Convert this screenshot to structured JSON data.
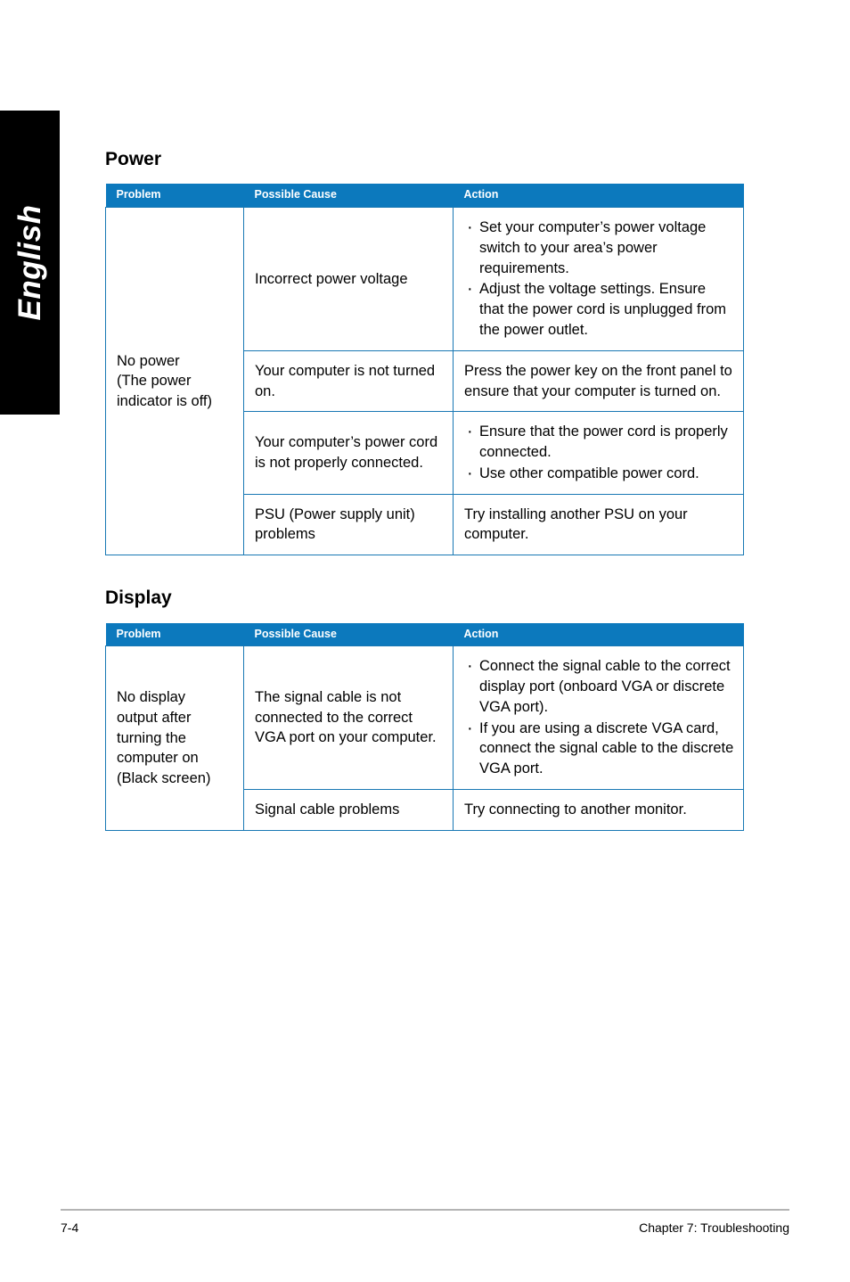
{
  "language_tab": {
    "label": "English"
  },
  "sections": [
    {
      "title": "Power",
      "columns": [
        "Problem",
        "Possible Cause",
        "Action"
      ],
      "rows": [
        {
          "problem": "No power\n(The power\nindicator is off)",
          "problem_rowspan": 4,
          "cause": "Incorrect power voltage",
          "action_bullets": [
            "Set your computer’s power voltage switch to your area’s power requirements.",
            "Adjust the voltage settings. Ensure that the power cord is unplugged from the power outlet."
          ]
        },
        {
          "cause": "Your computer is not turned on.",
          "action_text": "Press the power key on the front panel to ensure that your computer is turned on."
        },
        {
          "cause": "Your computer’s power cord is not properly connected.",
          "action_bullets": [
            "Ensure that the power cord is properly connected.",
            "Use other compatible power cord."
          ]
        },
        {
          "cause": "PSU (Power supply unit) problems",
          "action_text": "Try installing another PSU on your computer."
        }
      ]
    },
    {
      "title": "Display",
      "columns": [
        "Problem",
        "Possible Cause",
        "Action"
      ],
      "rows": [
        {
          "problem": "No display\noutput after\nturning the\ncomputer on\n(Black screen)",
          "problem_rowspan": 2,
          "cause": "The signal cable is not connected to the correct VGA port on your computer.",
          "action_bullets": [
            "Connect the signal cable to the correct display port (onboard VGA or discrete VGA port).",
            "If you are using a discrete VGA card, connect the signal cable to the discrete VGA port."
          ]
        },
        {
          "cause": "Signal cable problems",
          "action_text": "Try connecting to another monitor."
        }
      ]
    }
  ],
  "footer": {
    "page_number": "7-4",
    "chapter": "Chapter 7: Troubleshooting"
  },
  "colors": {
    "header_blue": "#0c79bd",
    "border_blue": "#1878b4",
    "tab_black": "#000000",
    "footer_rule": "#b4b4b4"
  }
}
